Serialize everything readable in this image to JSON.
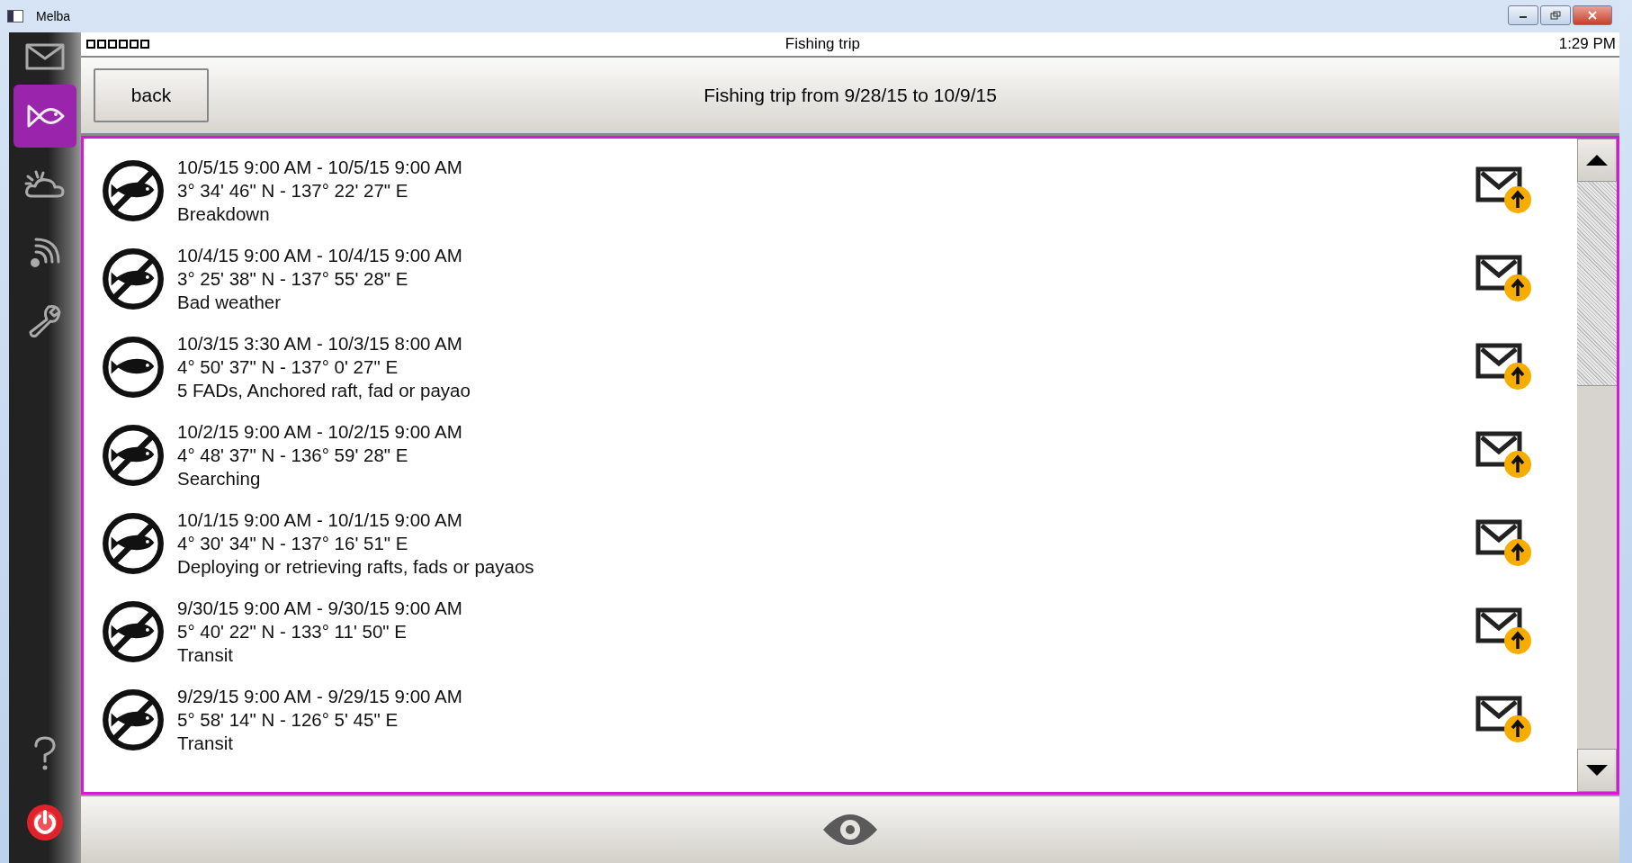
{
  "window": {
    "title": "Melba"
  },
  "sidebar": {
    "items": [
      {
        "kind": "mail",
        "selected": false
      },
      {
        "kind": "fish",
        "selected": true
      },
      {
        "kind": "weather",
        "selected": false
      },
      {
        "kind": "signal",
        "selected": false
      },
      {
        "kind": "wrench",
        "selected": false
      },
      {
        "kind": "help",
        "selected": false
      },
      {
        "kind": "power",
        "selected": false
      }
    ]
  },
  "status_bar": {
    "title": "Fishing trip",
    "time": "1:29 PM"
  },
  "header": {
    "back_button": "back",
    "title": "Fishing trip from 9/28/15 to 10/9/15"
  },
  "activities": [
    {
      "fishing": false,
      "time": "10/5/15 9:00 AM - 10/5/15 9:00 AM",
      "position": "3° 34' 46\" N - 137° 22' 27\" E",
      "activity": "Breakdown"
    },
    {
      "fishing": false,
      "time": "10/4/15 9:00 AM - 10/4/15 9:00 AM",
      "position": "3° 25' 38\" N - 137° 55' 28\" E",
      "activity": "Bad weather"
    },
    {
      "fishing": true,
      "time": "10/3/15 3:30 AM - 10/3/15 8:00 AM",
      "position": "4° 50' 37\" N - 137° 0' 27\" E",
      "activity": "5 FADs, Anchored raft, fad or payao"
    },
    {
      "fishing": false,
      "time": "10/2/15 9:00 AM - 10/2/15 9:00 AM",
      "position": "4° 48' 37\" N - 136° 59' 28\" E",
      "activity": "Searching"
    },
    {
      "fishing": false,
      "time": "10/1/15 9:00 AM - 10/1/15 9:00 AM",
      "position": "4° 30' 34\" N - 137° 16' 51\" E",
      "activity": "Deploying or retrieving rafts, fads or payaos"
    },
    {
      "fishing": false,
      "time": "9/30/15 9:00 AM - 9/30/15 9:00 AM",
      "position": "5° 40' 22\" N - 133° 11' 50\" E",
      "activity": "Transit"
    },
    {
      "fishing": false,
      "time": "9/29/15 9:00 AM - 9/29/15 9:00 AM",
      "position": "5° 58' 14\" N - 126° 5' 45\" E",
      "activity": "Transit"
    }
  ]
}
